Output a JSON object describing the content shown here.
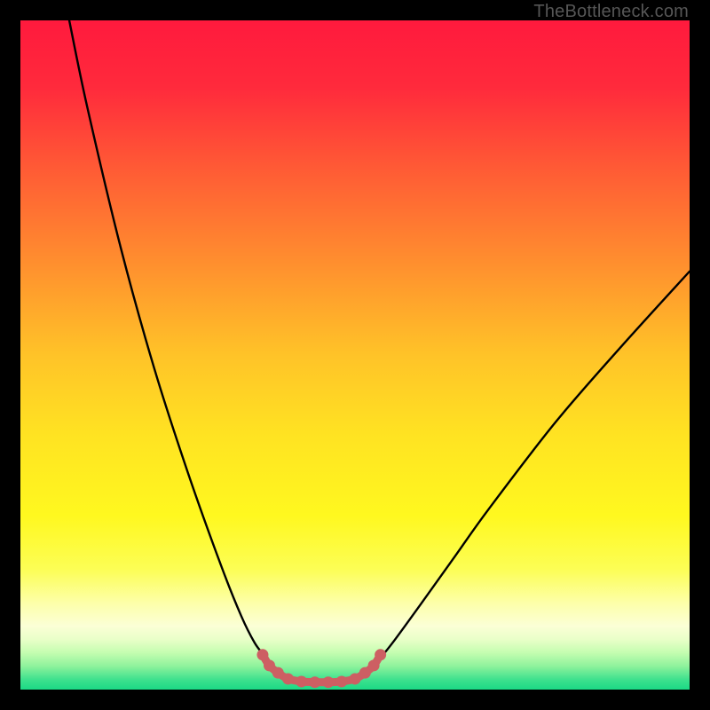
{
  "attribution": "TheBottleneck.com",
  "chart_data": {
    "type": "line",
    "title": "",
    "xlabel": "",
    "ylabel": "",
    "xlim": [
      0,
      100
    ],
    "ylim": [
      0,
      100
    ],
    "series": [
      {
        "name": "left-curve",
        "x": [
          7.3,
          10,
          15,
          20,
          25,
          30,
          33,
          35,
          36.5,
          37.5,
          39,
          41,
          43,
          45
        ],
        "y": [
          100,
          87,
          66,
          48,
          32.5,
          18.5,
          11,
          7,
          5,
          3.6,
          2.3,
          1.5,
          1.2,
          1.1
        ]
      },
      {
        "name": "right-curve",
        "x": [
          45,
          47,
          49,
          51,
          52.5,
          54,
          56,
          60,
          65,
          70,
          80,
          90,
          100
        ],
        "y": [
          1.1,
          1.2,
          1.5,
          2.3,
          3.6,
          5,
          7.5,
          13,
          20,
          27,
          40,
          51.5,
          62.5
        ]
      },
      {
        "name": "valley-marker-dots",
        "x": [
          36.2,
          37.2,
          38.5,
          40,
          42,
          44,
          46,
          48,
          50,
          51.5,
          52.8,
          53.8
        ],
        "y": [
          5.2,
          3.6,
          2.5,
          1.6,
          1.2,
          1.1,
          1.1,
          1.2,
          1.6,
          2.5,
          3.6,
          5.2
        ]
      }
    ],
    "background_gradient": {
      "stops": [
        {
          "offset": 0.0,
          "color": "#ff1a3d"
        },
        {
          "offset": 0.1,
          "color": "#ff2a3c"
        },
        {
          "offset": 0.22,
          "color": "#ff5a35"
        },
        {
          "offset": 0.35,
          "color": "#ff8a2f"
        },
        {
          "offset": 0.5,
          "color": "#ffc328"
        },
        {
          "offset": 0.62,
          "color": "#ffe322"
        },
        {
          "offset": 0.74,
          "color": "#fff81f"
        },
        {
          "offset": 0.82,
          "color": "#fcfe55"
        },
        {
          "offset": 0.87,
          "color": "#fdffa8"
        },
        {
          "offset": 0.905,
          "color": "#fbffd6"
        },
        {
          "offset": 0.925,
          "color": "#e9ffc8"
        },
        {
          "offset": 0.945,
          "color": "#c4fdb0"
        },
        {
          "offset": 0.965,
          "color": "#8ef29c"
        },
        {
          "offset": 0.985,
          "color": "#3ee18e"
        },
        {
          "offset": 1.0,
          "color": "#1bd985"
        }
      ]
    },
    "marker_color": "#cd5f63",
    "curve_color": "#000000"
  }
}
